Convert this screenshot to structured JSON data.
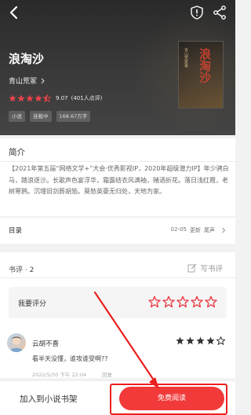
{
  "header": {
    "back_icon": "back-arrow-icon",
    "report_icon": "shield-alert-icon",
    "share_icon": "share-icon"
  },
  "book": {
    "title": "浪淘沙",
    "author": "青山荒冢",
    "score": "9.07",
    "rating_count": "(401人点评)",
    "tags": [
      "小说",
      "连载中",
      "168.67万字"
    ],
    "cover_title": "浪淘沙",
    "cover_author": "青山荒冢著"
  },
  "intro": {
    "heading": "简介",
    "text": "【2021年第五届“网络文学+”大会·优秀影视IP，2020年超级潜力IP】年少骋白马，踏浪逐沙。长歌声色宴浮华，霜露结衣风满袖，赌酒折花。落日浅红霞，老树寒鸦。沉埋旧剑葬胡笳。莫愁英豪无归处，天地为家。"
  },
  "toc": {
    "label": "目录",
    "date": "02-05",
    "update": "更新",
    "last": "尾声"
  },
  "reviews": {
    "title": "书评 · 2",
    "write_label": "写书评",
    "my_rating_label": "我要评分",
    "comment": {
      "user": "云胡不喜",
      "text": "看半天没懂，谁攻谁受啊??",
      "time": "2022/5/30 下午 22:04",
      "reply": "回复"
    }
  },
  "bottom_bar": {
    "add_shelf": "加入到小说书架",
    "read_free": "免费阅读"
  },
  "colors": {
    "accent": "#f23a3a",
    "annotation": "#ec1f1f",
    "star": "#e8424a",
    "hero_bg": "#2f2f2f"
  }
}
